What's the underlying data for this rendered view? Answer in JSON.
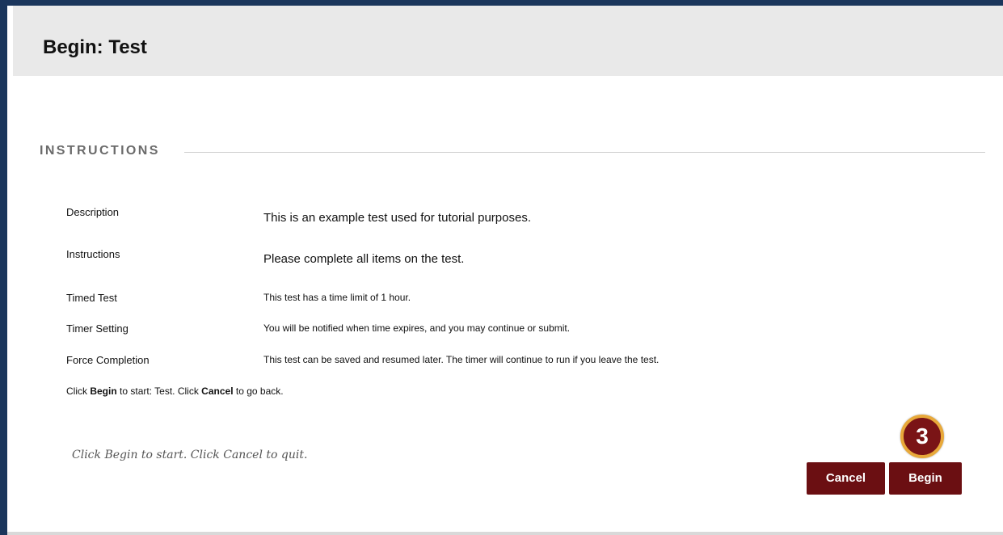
{
  "header": {
    "title": "Begin: Test"
  },
  "section": {
    "heading": "INSTRUCTIONS"
  },
  "details": [
    {
      "label": "Description",
      "value": "This is an example test used for tutorial purposes."
    },
    {
      "label": "Instructions",
      "value": "Please complete all items on the test."
    },
    {
      "label": "Timed Test",
      "value": "This test has a time limit of 1 hour."
    },
    {
      "label": "Timer Setting",
      "value": "You will be notified when time expires, and you may continue or submit."
    },
    {
      "label": "Force Completion",
      "value": "This test can be saved and resumed later. The timer will continue to run if you leave the test."
    }
  ],
  "hint": {
    "prefix": "Click ",
    "begin_word": "Begin",
    "middle": " to start: Test. Click ",
    "cancel_word": "Cancel",
    "suffix": " to go back."
  },
  "footer": {
    "note": "Click Begin to start. Click Cancel to quit.",
    "cancel_label": "Cancel",
    "begin_label": "Begin"
  },
  "step_badge": {
    "number": "3"
  },
  "colors": {
    "frame": "#1b365c",
    "header_bg": "#e9e9e9",
    "button_bg": "#6b0f12",
    "badge_ring": "#e8a93a"
  }
}
